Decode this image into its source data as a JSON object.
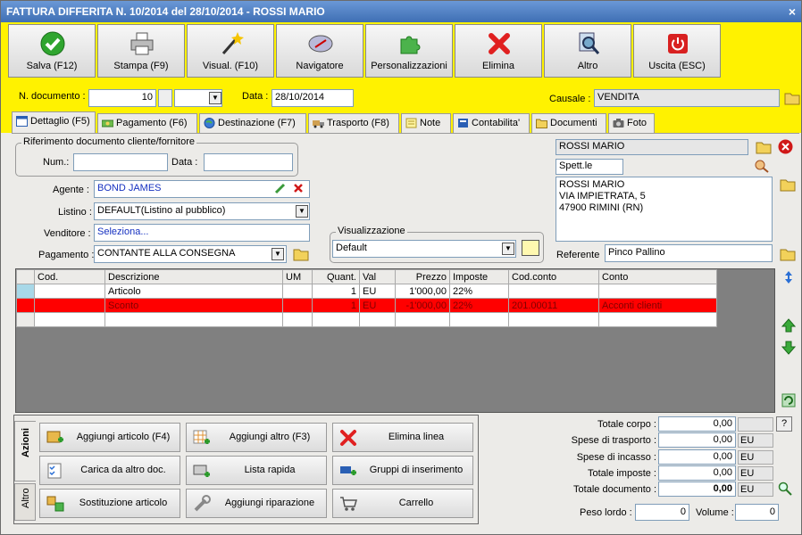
{
  "window": {
    "title": "FATTURA DIFFERITA N. 10/2014 del 28/10/2014 - ROSSI MARIO",
    "close": "×"
  },
  "colors": {
    "toolbar_bg": "#fff200",
    "selected_row": "#ff0000",
    "titlebar": "#3f6fb4"
  },
  "toolbar": {
    "buttons": [
      {
        "label": "Salva (F12)",
        "icon": "check-icon"
      },
      {
        "label": "Stampa (F9)",
        "icon": "printer-icon"
      },
      {
        "label": "Visual. (F10)",
        "icon": "magic-wand-icon"
      },
      {
        "label": "Navigatore",
        "icon": "compass-icon"
      },
      {
        "label": "Personalizzazioni",
        "icon": "puzzle-icon"
      },
      {
        "label": "Elimina",
        "icon": "delete-x-icon"
      },
      {
        "label": "Altro",
        "icon": "magnifier-icon"
      },
      {
        "label": "Uscita (ESC)",
        "icon": "power-icon"
      }
    ]
  },
  "header": {
    "doc_number_label": "N. documento :",
    "doc_number": "10",
    "date_label": "Data :",
    "date": "28/10/2014",
    "causale_label": "Causale :",
    "causale": "VENDITA"
  },
  "tabs": [
    {
      "label": "Dettaglio (F5)",
      "icon": "window-icon"
    },
    {
      "label": "Pagamento (F6)",
      "icon": "money-icon"
    },
    {
      "label": "Destinazione (F7)",
      "icon": "globe-icon"
    },
    {
      "label": "Trasporto (F8)",
      "icon": "truck-icon"
    },
    {
      "label": "Note",
      "icon": "note-icon"
    },
    {
      "label": "Contabilita'",
      "icon": "book-icon"
    },
    {
      "label": "Documenti",
      "icon": "folder-icon"
    },
    {
      "label": "Foto",
      "icon": "camera-icon"
    }
  ],
  "riferimento": {
    "title": "Riferimento documento cliente/fornitore",
    "num_label": "Num.:",
    "num": "",
    "data_label": "Data :",
    "data": ""
  },
  "form": {
    "agente_label": "Agente :",
    "agente": "BOND JAMES",
    "listino_label": "Listino :",
    "listino": "DEFAULT(Listino al pubblico)",
    "venditore_label": "Venditore :",
    "venditore": "Seleziona...",
    "pagamento_label": "Pagamento :",
    "pagamento": "CONTANTE ALLA CONSEGNA"
  },
  "visualizzazione": {
    "title": "Visualizzazione",
    "value": "Default"
  },
  "cliente": {
    "name": "ROSSI MARIO",
    "title": "Spett.le",
    "address_lines": [
      "ROSSI MARIO",
      "VIA IMPIETRATA, 5",
      "47900 RIMINI (RN)"
    ],
    "referente_label": "Referente",
    "referente": "Pinco Pallino"
  },
  "grid": {
    "columns": [
      "Cod.",
      "Descrizione",
      "UM",
      "Quant.",
      "Val",
      "Prezzo",
      "Imposte",
      "Cod.conto",
      "Conto"
    ],
    "rows": [
      {
        "cod": "",
        "descrizione": "Articolo",
        "um": "",
        "quant": "1",
        "val": "EU",
        "prezzo": "1'000,00",
        "imposte": "22%",
        "codconto": "",
        "conto": ""
      },
      {
        "cod": "",
        "descrizione": "Sconto",
        "um": "",
        "quant": "1",
        "val": "EU",
        "prezzo": "-1'000,00",
        "imposte": "22%",
        "codconto": "201.00011",
        "conto": "Acconti clienti"
      },
      {
        "cod": "",
        "descrizione": "",
        "um": "",
        "quant": "",
        "val": "",
        "prezzo": "",
        "imposte": "",
        "codconto": "",
        "conto": ""
      }
    ]
  },
  "actions": {
    "tab_azioni": "Azioni",
    "tab_altro": "Altro",
    "buttons": [
      {
        "label": "Aggiungi articolo (F4)",
        "icon": "box-add-icon"
      },
      {
        "label": "Aggiungi altro (F3)",
        "icon": "grid-add-icon"
      },
      {
        "label": "Elimina linea",
        "icon": "delete-x-icon"
      },
      {
        "label": "Carica da altro doc.",
        "icon": "checklist-icon"
      },
      {
        "label": "Lista rapida",
        "icon": "scanner-icon"
      },
      {
        "label": "Gruppi di inserimento",
        "icon": "group-add-icon"
      },
      {
        "label": "Sostituzione articolo",
        "icon": "replace-icon"
      },
      {
        "label": "Aggiungi riparazione",
        "icon": "wrench-icon"
      },
      {
        "label": "Carrello",
        "icon": "cart-icon"
      }
    ]
  },
  "totals": {
    "totale_corpo_label": "Totale corpo :",
    "totale_corpo": "0,00",
    "help": "?",
    "spese_trasporto_label": "Spese di trasporto :",
    "spese_trasporto": "0,00",
    "spese_incasso_label": "Spese di incasso :",
    "spese_incasso": "0,00",
    "totale_imposte_label": "Totale imposte :",
    "totale_imposte": "0,00",
    "totale_documento_label": "Totale documento :",
    "totale_documento": "0,00",
    "currency": "EU",
    "peso_lordo_label": "Peso lordo :",
    "peso_lordo": "0",
    "volume_label": "Volume :",
    "volume": "0"
  }
}
